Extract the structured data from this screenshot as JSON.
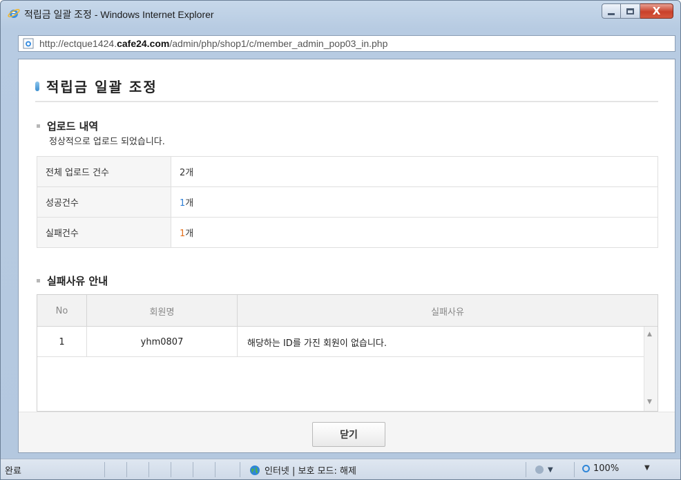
{
  "window": {
    "title": "적립금 일괄 조정 - Windows Internet Explorer",
    "controls": {
      "min": "—",
      "max": "□",
      "close": "X"
    }
  },
  "address": {
    "prefix": "http://ectque1424.",
    "domain": "cafe24.com",
    "path": "/admin/php/shop1/c/member_admin_pop03_in.php"
  },
  "page": {
    "title": "적립금 일괄 조정"
  },
  "upload": {
    "section_title": "업로드 내역",
    "message": "정상적으로 업로드 되었습니다.",
    "rows": [
      {
        "label": "전체 업로드 건수",
        "count": "2",
        "unit": "개"
      },
      {
        "label": "성공건수",
        "count": "1",
        "unit": "개"
      },
      {
        "label": "실패건수",
        "count": "1",
        "unit": "개"
      }
    ]
  },
  "failure": {
    "section_title": "실패사유 안내",
    "headers": {
      "no": "No",
      "member": "회원명",
      "reason": "실패사유"
    },
    "rows": [
      {
        "no": "1",
        "member": "yhm0807",
        "reason": "해당하는 ID를 가진 회원이 없습니다."
      }
    ]
  },
  "footer": {
    "close_label": "닫기"
  },
  "statusbar": {
    "status": "완료",
    "zone": "인터넷 | 보호 모드: 해제",
    "zoom": "100%",
    "security_dropdown": "▼",
    "zoom_dropdown": "▼"
  },
  "colors": {
    "success_count": "#2f7fd6",
    "failure_count": "#e36f1c",
    "title_accent": "#3c8fd0"
  }
}
